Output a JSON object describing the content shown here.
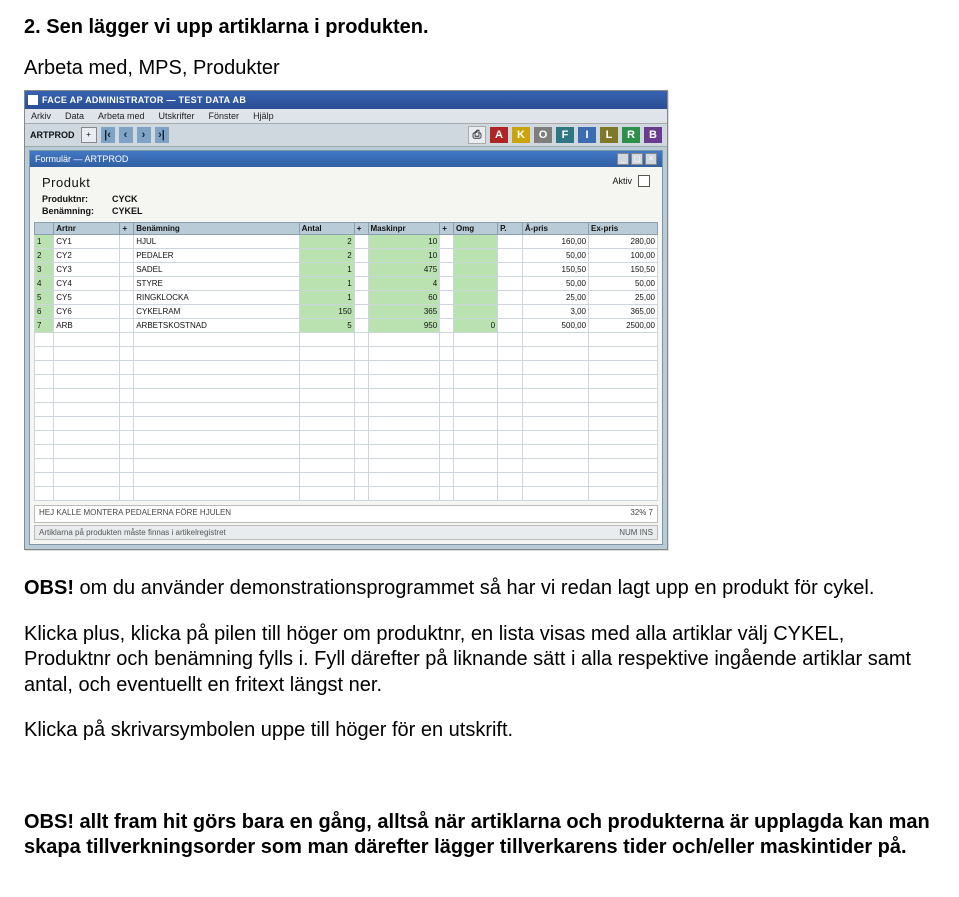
{
  "doc": {
    "heading": "2. Sen lägger vi upp artiklarna i produkten.",
    "subtitle": "Arbeta med, MPS, Produkter",
    "obs1_prefix": "OBS!",
    "obs1_rest": " om du använder demonstrationsprogrammet så har vi redan lagt upp en produkt för cykel.",
    "para2": "Klicka plus, klicka på pilen till höger om produktnr, en lista visas med alla artiklar välj CYKEL, Produktnr och benämning fylls i. Fyll därefter på liknande sätt i alla respektive ingående artiklar samt antal, och eventuellt en fritext längst ner.",
    "para3": "Klicka på skrivarsymbolen uppe till höger för en utskrift.",
    "obs2_prefix": "OBS!",
    "obs2_rest": " allt fram hit görs bara en gång, alltså när artiklarna och produkterna är upplagda kan man skapa tillverkningsorder som man därefter lägger tillverkarens tider och/eller maskintider på."
  },
  "app": {
    "title": "FACE AP ADMINISTRATOR — TEST DATA AB",
    "menubar": [
      "Arkiv",
      "Data",
      "Arbeta med",
      "Utskrifter",
      "Fönster",
      "Hjälp"
    ],
    "toolbar_label": "ARTPROD",
    "nav_icons": [
      "+",
      "|‹",
      "‹",
      "›",
      "›|"
    ],
    "print_label": "⎙",
    "tiles": [
      "A",
      "K",
      "O",
      "F",
      "I",
      "L",
      "R",
      "B"
    ],
    "child_title": "Formulär — ARTPROD",
    "panel_title": "Produkt",
    "aktiv_label": "Aktiv",
    "fields": {
      "produktnr_label": "Produktnr:",
      "produktnr_value": "CYCK",
      "benamning_label": "Benämning:",
      "benamning_value": "CYKEL"
    },
    "columns": [
      "",
      "Artnr",
      "+",
      "Benämning",
      "Antal",
      "+",
      "Maskinpr",
      "+",
      "Omg",
      "P.",
      "Å-pris",
      "Ex-pris"
    ],
    "col_widths": [
      "14px",
      "48px",
      "10px",
      "120px",
      "40px",
      "10px",
      "52px",
      "10px",
      "32px",
      "18px",
      "48px",
      "50px"
    ],
    "rows": [
      {
        "n": "1",
        "art": "CY1",
        "ben": "HJUL",
        "antal": "2",
        "mask": "10",
        "omg": "",
        "p": "",
        "apris": "160,00",
        "expris": "280,00"
      },
      {
        "n": "2",
        "art": "CY2",
        "ben": "PEDALER",
        "antal": "2",
        "mask": "10",
        "omg": "",
        "p": "",
        "apris": "50,00",
        "expris": "100,00"
      },
      {
        "n": "3",
        "art": "CY3",
        "ben": "SADEL",
        "antal": "1",
        "mask": "475",
        "omg": "",
        "p": "",
        "apris": "150,50",
        "expris": "150,50"
      },
      {
        "n": "4",
        "art": "CY4",
        "ben": "STYRE",
        "antal": "1",
        "mask": "4",
        "omg": "",
        "p": "",
        "apris": "50,00",
        "expris": "50,00"
      },
      {
        "n": "5",
        "art": "CY5",
        "ben": "RINGKLOCKA",
        "antal": "1",
        "mask": "60",
        "omg": "",
        "p": "",
        "apris": "25,00",
        "expris": "25,00"
      },
      {
        "n": "6",
        "art": "CY6",
        "ben": "CYKELRAM",
        "antal": "150",
        "mask": "365",
        "omg": "",
        "p": "",
        "apris": "3,00",
        "expris": "365,00"
      },
      {
        "n": "7",
        "art": "ARB",
        "ben": "ARBETSKOSTNAD",
        "antal": "5",
        "mask": "950",
        "omg": "0",
        "p": "",
        "apris": "500,00",
        "expris": "2500,00"
      }
    ],
    "empty_row_count": 12,
    "note_text": "HEJ KALLE MONTERA PEDALERNA FÖRE HJULEN",
    "note_right": "32% 7",
    "status_left": "Artiklarna på produkten måste finnas i artikelregistret",
    "status_right": "NUM  INS"
  }
}
